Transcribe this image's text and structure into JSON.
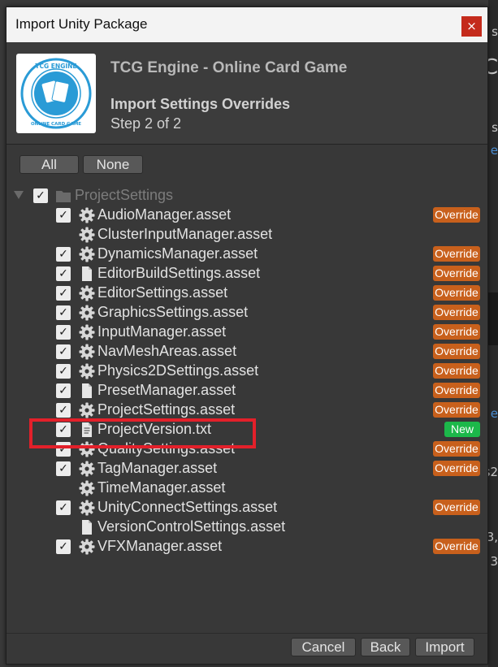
{
  "window": {
    "title": "Import Unity Package",
    "close_glyph": "×"
  },
  "header": {
    "package_title": "TCG Engine - Online Card Game",
    "step_title": "Import Settings Overrides",
    "step_subtitle": "Step 2 of 2",
    "logo": {
      "top_text": "TCG ENGINE",
      "bottom_text": "ONLINE CARD GAME"
    }
  },
  "selection": {
    "all_label": "All",
    "none_label": "None"
  },
  "tree": {
    "root": {
      "label": "ProjectSettings",
      "checked": true,
      "expanded": true
    },
    "items": [
      {
        "label": "AudioManager.asset",
        "checked": true,
        "icon": "gear-icon",
        "badge": "Override"
      },
      {
        "label": "ClusterInputManager.asset",
        "checked": false,
        "icon": "gear-icon",
        "badge": ""
      },
      {
        "label": "DynamicsManager.asset",
        "checked": true,
        "icon": "gear-icon",
        "badge": "Override"
      },
      {
        "label": "EditorBuildSettings.asset",
        "checked": true,
        "icon": "file-icon",
        "badge": "Override"
      },
      {
        "label": "EditorSettings.asset",
        "checked": true,
        "icon": "gear-icon",
        "badge": "Override"
      },
      {
        "label": "GraphicsSettings.asset",
        "checked": true,
        "icon": "gear-icon",
        "badge": "Override"
      },
      {
        "label": "InputManager.asset",
        "checked": true,
        "icon": "gear-icon",
        "badge": "Override"
      },
      {
        "label": "NavMeshAreas.asset",
        "checked": true,
        "icon": "gear-icon",
        "badge": "Override"
      },
      {
        "label": "Physics2DSettings.asset",
        "checked": true,
        "icon": "gear-icon",
        "badge": "Override"
      },
      {
        "label": "PresetManager.asset",
        "checked": true,
        "icon": "file-icon",
        "badge": "Override"
      },
      {
        "label": "ProjectSettings.asset",
        "checked": true,
        "icon": "gear-icon",
        "badge": "Override"
      },
      {
        "label": "ProjectVersion.txt",
        "checked": true,
        "icon": "text-file-icon",
        "badge": "New"
      },
      {
        "label": "QualitySettings.asset",
        "checked": true,
        "icon": "gear-icon",
        "badge": "Override"
      },
      {
        "label": "TagManager.asset",
        "checked": true,
        "icon": "gear-icon",
        "badge": "Override"
      },
      {
        "label": "TimeManager.asset",
        "checked": false,
        "icon": "gear-icon",
        "badge": ""
      },
      {
        "label": "UnityConnectSettings.asset",
        "checked": true,
        "icon": "gear-icon",
        "badge": "Override"
      },
      {
        "label": "VersionControlSettings.asset",
        "checked": false,
        "icon": "file-icon",
        "badge": ""
      },
      {
        "label": "VFXManager.asset",
        "checked": true,
        "icon": "gear-icon",
        "badge": "Override"
      }
    ]
  },
  "footer": {
    "cancel_label": "Cancel",
    "back_label": "Back",
    "import_label": "Import"
  },
  "colors": {
    "override": "#c8601c",
    "new": "#1cb84a",
    "highlight": "#e3202a"
  },
  "background": {
    "glyphs": [
      "s",
      "C",
      "C",
      "s",
      "e",
      "e",
      "s",
      "s2",
      "3,",
      "3"
    ]
  }
}
